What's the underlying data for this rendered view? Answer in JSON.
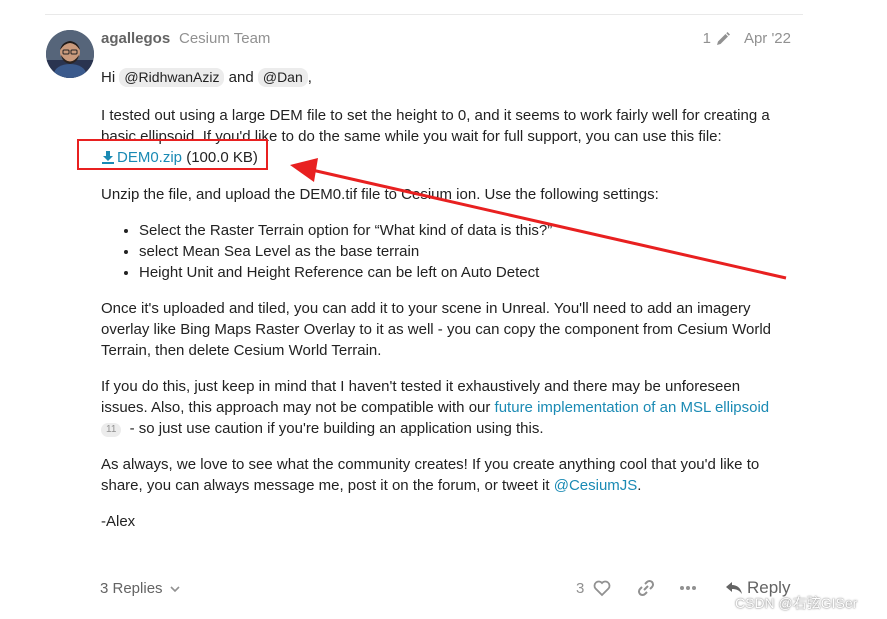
{
  "post": {
    "username": "agallegos",
    "user_title": "Cesium Team",
    "edit_count": "1",
    "date": "Apr '22",
    "greeting_start": "Hi",
    "mention_1": "@RidhwanAziz",
    "greeting_and": "and",
    "mention_2": "@Dan",
    "greeting_end": ",",
    "para1": "I tested out using a large DEM file to set the height to 0, and it seems to work fairly well for creating a basic ellipsoid. If you'd like to do the same while you wait for full support, you can use this file:",
    "attachment_name": "DEM0.zip",
    "attachment_size": "(100.0 KB)",
    "para2": "Unzip the file, and upload the DEM0.tif file to Cesium ion. Use the following settings:",
    "bullets": [
      "Select the Raster Terrain option for “What kind of data is this?”",
      "select Mean Sea Level as the base terrain",
      "Height Unit and Height Reference can be left on Auto Detect"
    ],
    "para3": "Once it's uploaded and tiled, you can add it to your scene in Unreal. You'll need to add an imagery overlay like Bing Maps Raster Overlay to it as well - you can copy the component from Cesium World Terrain, then delete Cesium World Terrain.",
    "para4_start": "If you do this, just keep in mind that I haven't tested it exhaustively and there may be unforeseen issues. Also, this approach may not be compatible with our",
    "para4_link": "future implementation of an MSL ellipsoid",
    "para4_badge": "11",
    "para4_end": "- so just use caution if you're building an application using this.",
    "para5_start": "As always, we love to see what the community creates! If you create anything cool that you'd like to share, you can always message me, post it on the forum, or tweet it",
    "para5_link": "@CesiumJS",
    "para5_end": ".",
    "signature": "-Alex"
  },
  "footer": {
    "replies_label": "3 Replies",
    "like_count": "3",
    "reply_label": "Reply"
  },
  "watermark": "CSDN @右弦GISer",
  "colors": {
    "link": "#1a8ab4",
    "annotation_red": "#e82020",
    "muted": "#919191"
  },
  "icons": [
    "pencil-icon",
    "download-icon",
    "chevron-down-icon",
    "heart-icon",
    "link-icon",
    "ellipsis-icon",
    "reply-arrow-icon"
  ]
}
